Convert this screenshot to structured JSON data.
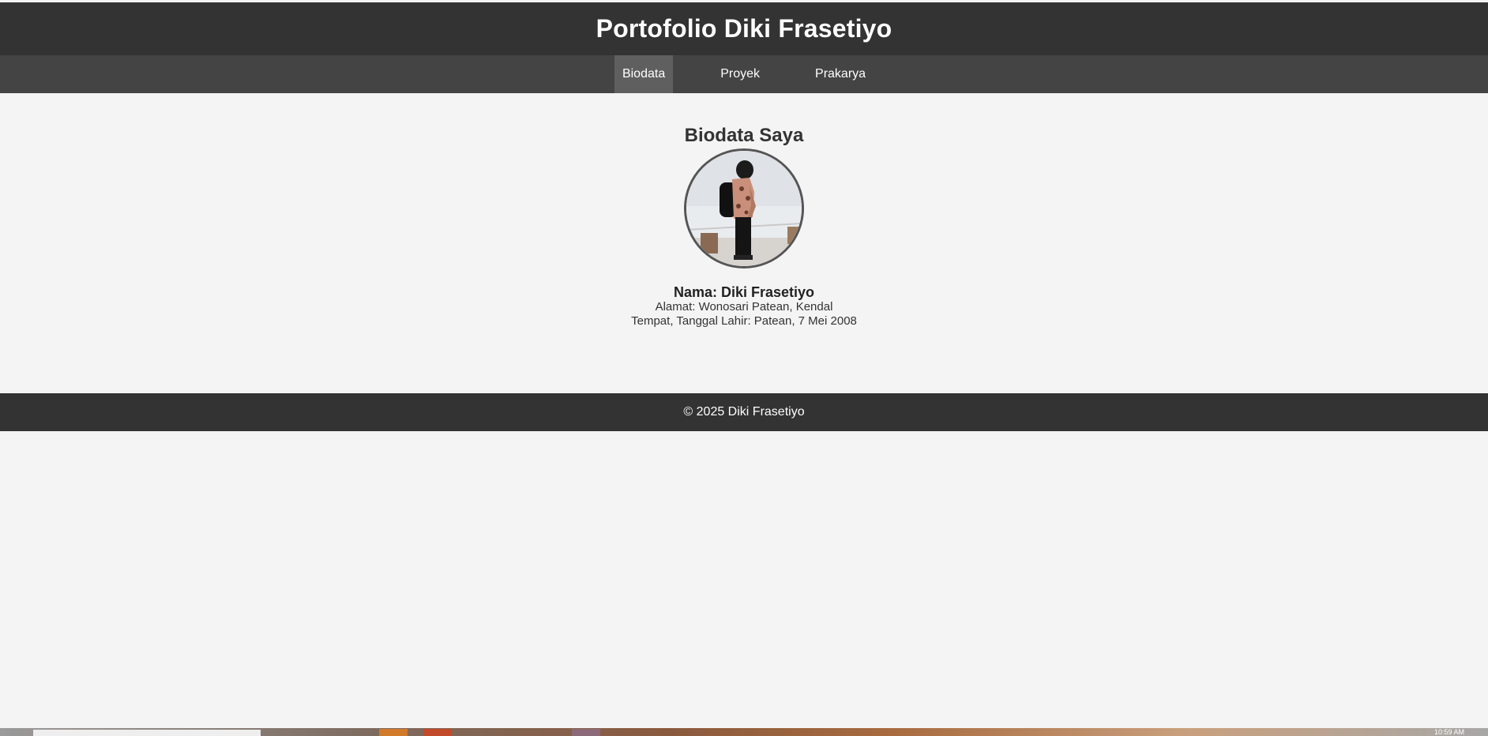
{
  "header": {
    "title": "Portofolio Diki Frasetiyo"
  },
  "nav": {
    "items": [
      {
        "label": "Biodata",
        "active": true
      },
      {
        "label": "Proyek",
        "active": false
      },
      {
        "label": "Prakarya",
        "active": false
      }
    ]
  },
  "biodata": {
    "section_title": "Biodata Saya",
    "photo_icon": "profile-photo",
    "name": "Nama: Diki Frasetiyo",
    "address": "Alamat: Wonosari Patean, Kendal",
    "birth": "Tempat, Tanggal Lahir: Patean, 7 Mei 2008"
  },
  "footer": {
    "text": "© 2025 Diki Frasetiyo"
  },
  "taskbar": {
    "clock": "10:59 AM"
  },
  "colors": {
    "header_bg": "#333333",
    "nav_bg": "#444444",
    "nav_active_bg": "#5f5f5f",
    "page_bg": "#f4f4f4",
    "footer_bg": "#333333"
  }
}
